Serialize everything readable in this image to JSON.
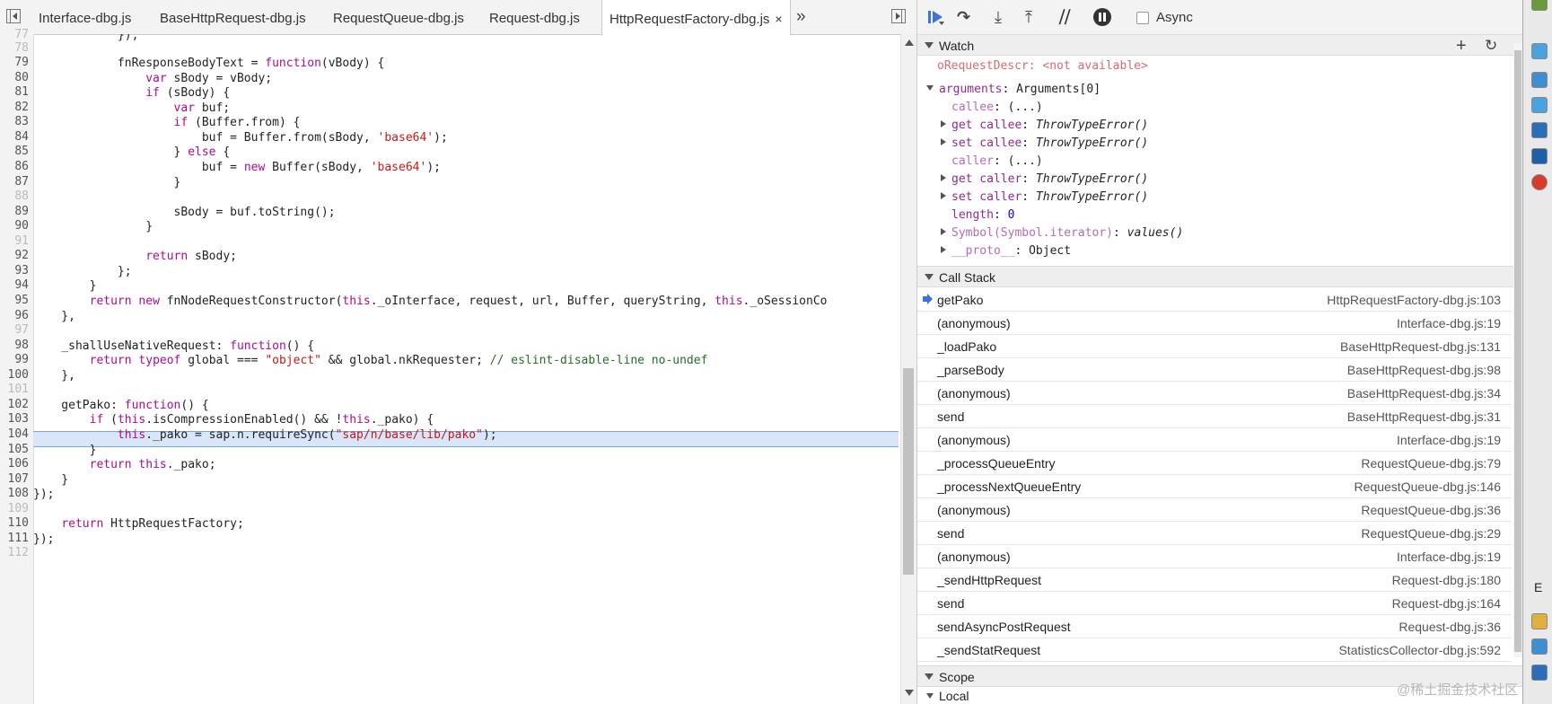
{
  "editor": {
    "tabs": [
      {
        "label": "Interface-dbg.js"
      },
      {
        "label": "BaseHttpRequest-dbg.js"
      },
      {
        "label": "RequestQueue-dbg.js"
      },
      {
        "label": "Request-dbg.js"
      },
      {
        "label": "HttpRequestFactory-dbg.js",
        "active": true,
        "close": "×"
      }
    ],
    "overflow_label": "»",
    "line_numbers": [
      "77",
      "78",
      "79",
      "80",
      "81",
      "82",
      "83",
      "84",
      "85",
      "86",
      "87",
      "88",
      "89",
      "90",
      "91",
      "92",
      "93",
      "94",
      "95",
      "96",
      "97",
      "98",
      "99",
      "100",
      "101",
      "102",
      "103",
      "104",
      "105",
      "106",
      "107",
      "108",
      "109",
      "110",
      "111",
      "112"
    ],
    "current_line": "103"
  },
  "debugger": {
    "async_label": "Async",
    "watch": {
      "title": "Watch",
      "add_label": "+",
      "refresh_label": "↻",
      "items": [
        {
          "name": "oRequestDescr",
          "sep": ": ",
          "value": "<not available>"
        },
        {
          "name": "arguments",
          "sep": ": ",
          "value": "Arguments[0]"
        },
        {
          "name": "callee",
          "sep": ": ",
          "value": "(...)"
        },
        {
          "name": "get callee",
          "sep": ": ",
          "value": "ThrowTypeError()"
        },
        {
          "name": "set callee",
          "sep": ": ",
          "value": "ThrowTypeError()"
        },
        {
          "name": "caller",
          "sep": ": ",
          "value": "(...)"
        },
        {
          "name": "get caller",
          "sep": ": ",
          "value": "ThrowTypeError()"
        },
        {
          "name": "set caller",
          "sep": ": ",
          "value": "ThrowTypeError()"
        },
        {
          "name": "length",
          "sep": ": ",
          "value": "0"
        },
        {
          "name": "Symbol(Symbol.iterator)",
          "sep": ": ",
          "value": "values()"
        },
        {
          "name": "__proto__",
          "sep": ": ",
          "value": "Object"
        }
      ]
    },
    "call_stack": {
      "title": "Call Stack",
      "frames": [
        {
          "fn": "getPako",
          "loc": "HttpRequestFactory-dbg.js:103"
        },
        {
          "fn": "(anonymous)",
          "loc": "Interface-dbg.js:19"
        },
        {
          "fn": "_loadPako",
          "loc": "BaseHttpRequest-dbg.js:131"
        },
        {
          "fn": "_parseBody",
          "loc": "BaseHttpRequest-dbg.js:98"
        },
        {
          "fn": "(anonymous)",
          "loc": "BaseHttpRequest-dbg.js:34"
        },
        {
          "fn": "send",
          "loc": "BaseHttpRequest-dbg.js:31"
        },
        {
          "fn": "(anonymous)",
          "loc": "Interface-dbg.js:19"
        },
        {
          "fn": "_processQueueEntry",
          "loc": "RequestQueue-dbg.js:79"
        },
        {
          "fn": "_processNextQueueEntry",
          "loc": "RequestQueue-dbg.js:146"
        },
        {
          "fn": "(anonymous)",
          "loc": "RequestQueue-dbg.js:36"
        },
        {
          "fn": "send",
          "loc": "RequestQueue-dbg.js:29"
        },
        {
          "fn": "(anonymous)",
          "loc": "Interface-dbg.js:19"
        },
        {
          "fn": "_sendHttpRequest",
          "loc": "Request-dbg.js:180"
        },
        {
          "fn": "send",
          "loc": "Request-dbg.js:164"
        },
        {
          "fn": "sendAsyncPostRequest",
          "loc": "Request-dbg.js:36"
        },
        {
          "fn": "_sendStatRequest",
          "loc": "StatisticsCollector-dbg.js:592"
        }
      ]
    },
    "scope": {
      "title": "Scope",
      "local_label": "Local"
    }
  },
  "window_edge": {
    "letter": "E"
  },
  "watermark": "@稀土掘金技术社区",
  "colors": {
    "accent": "#3b73d6",
    "highlight": "#d8e6f8",
    "keyword": "#aa0d91",
    "string": "#c41a16",
    "comment": "#236e25"
  }
}
